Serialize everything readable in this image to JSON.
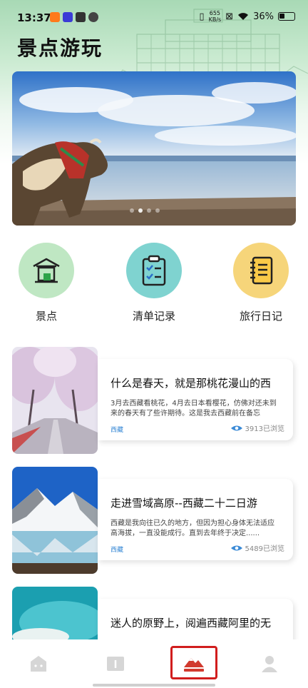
{
  "status_bar": {
    "time": "13:37",
    "net_speed_value": "655",
    "net_speed_unit": "KB/s",
    "battery": "36%"
  },
  "page": {
    "title": "景点游玩"
  },
  "banner": {
    "slide_count": 4,
    "active_index": 1
  },
  "quick_entries": [
    {
      "label": "景点",
      "icon": "pavilion-icon",
      "color": "#bfe7c3"
    },
    {
      "label": "清单记录",
      "icon": "clipboard-checklist-icon",
      "color": "#7fd3d0"
    },
    {
      "label": "旅行日记",
      "icon": "notebook-icon",
      "color": "#f6d57a"
    }
  ],
  "articles": [
    {
      "title": "什么是春天，就是那桃花漫山的西",
      "desc": "3月去西藏看桃花，4月去日本看樱花，仿佛对还未到来的春天有了些许期待。这是我去西藏前在备忘",
      "tag": "西藏",
      "views": "3913已浏览"
    },
    {
      "title": "走进雪域高原--西藏二十二日游",
      "desc": "西藏是我向往已久的地方，但因为担心身体无法适应高海拔，一直没能成行。直到去年终于决定......",
      "tag": "西藏",
      "views": "5489已浏览"
    },
    {
      "title": "迷人的原野上，阅遍西藏阿里的无"
    }
  ],
  "bottom_nav": [
    {
      "icon": "home-face-icon"
    },
    {
      "icon": "map-book-icon"
    },
    {
      "icon": "mountain-scenery-icon",
      "active": true
    },
    {
      "icon": "user-profile-icon"
    }
  ],
  "colors": {
    "accent_blue": "#3a8ad6",
    "highlight_red": "#d11d1d",
    "header_green": "#a8d9b5"
  }
}
